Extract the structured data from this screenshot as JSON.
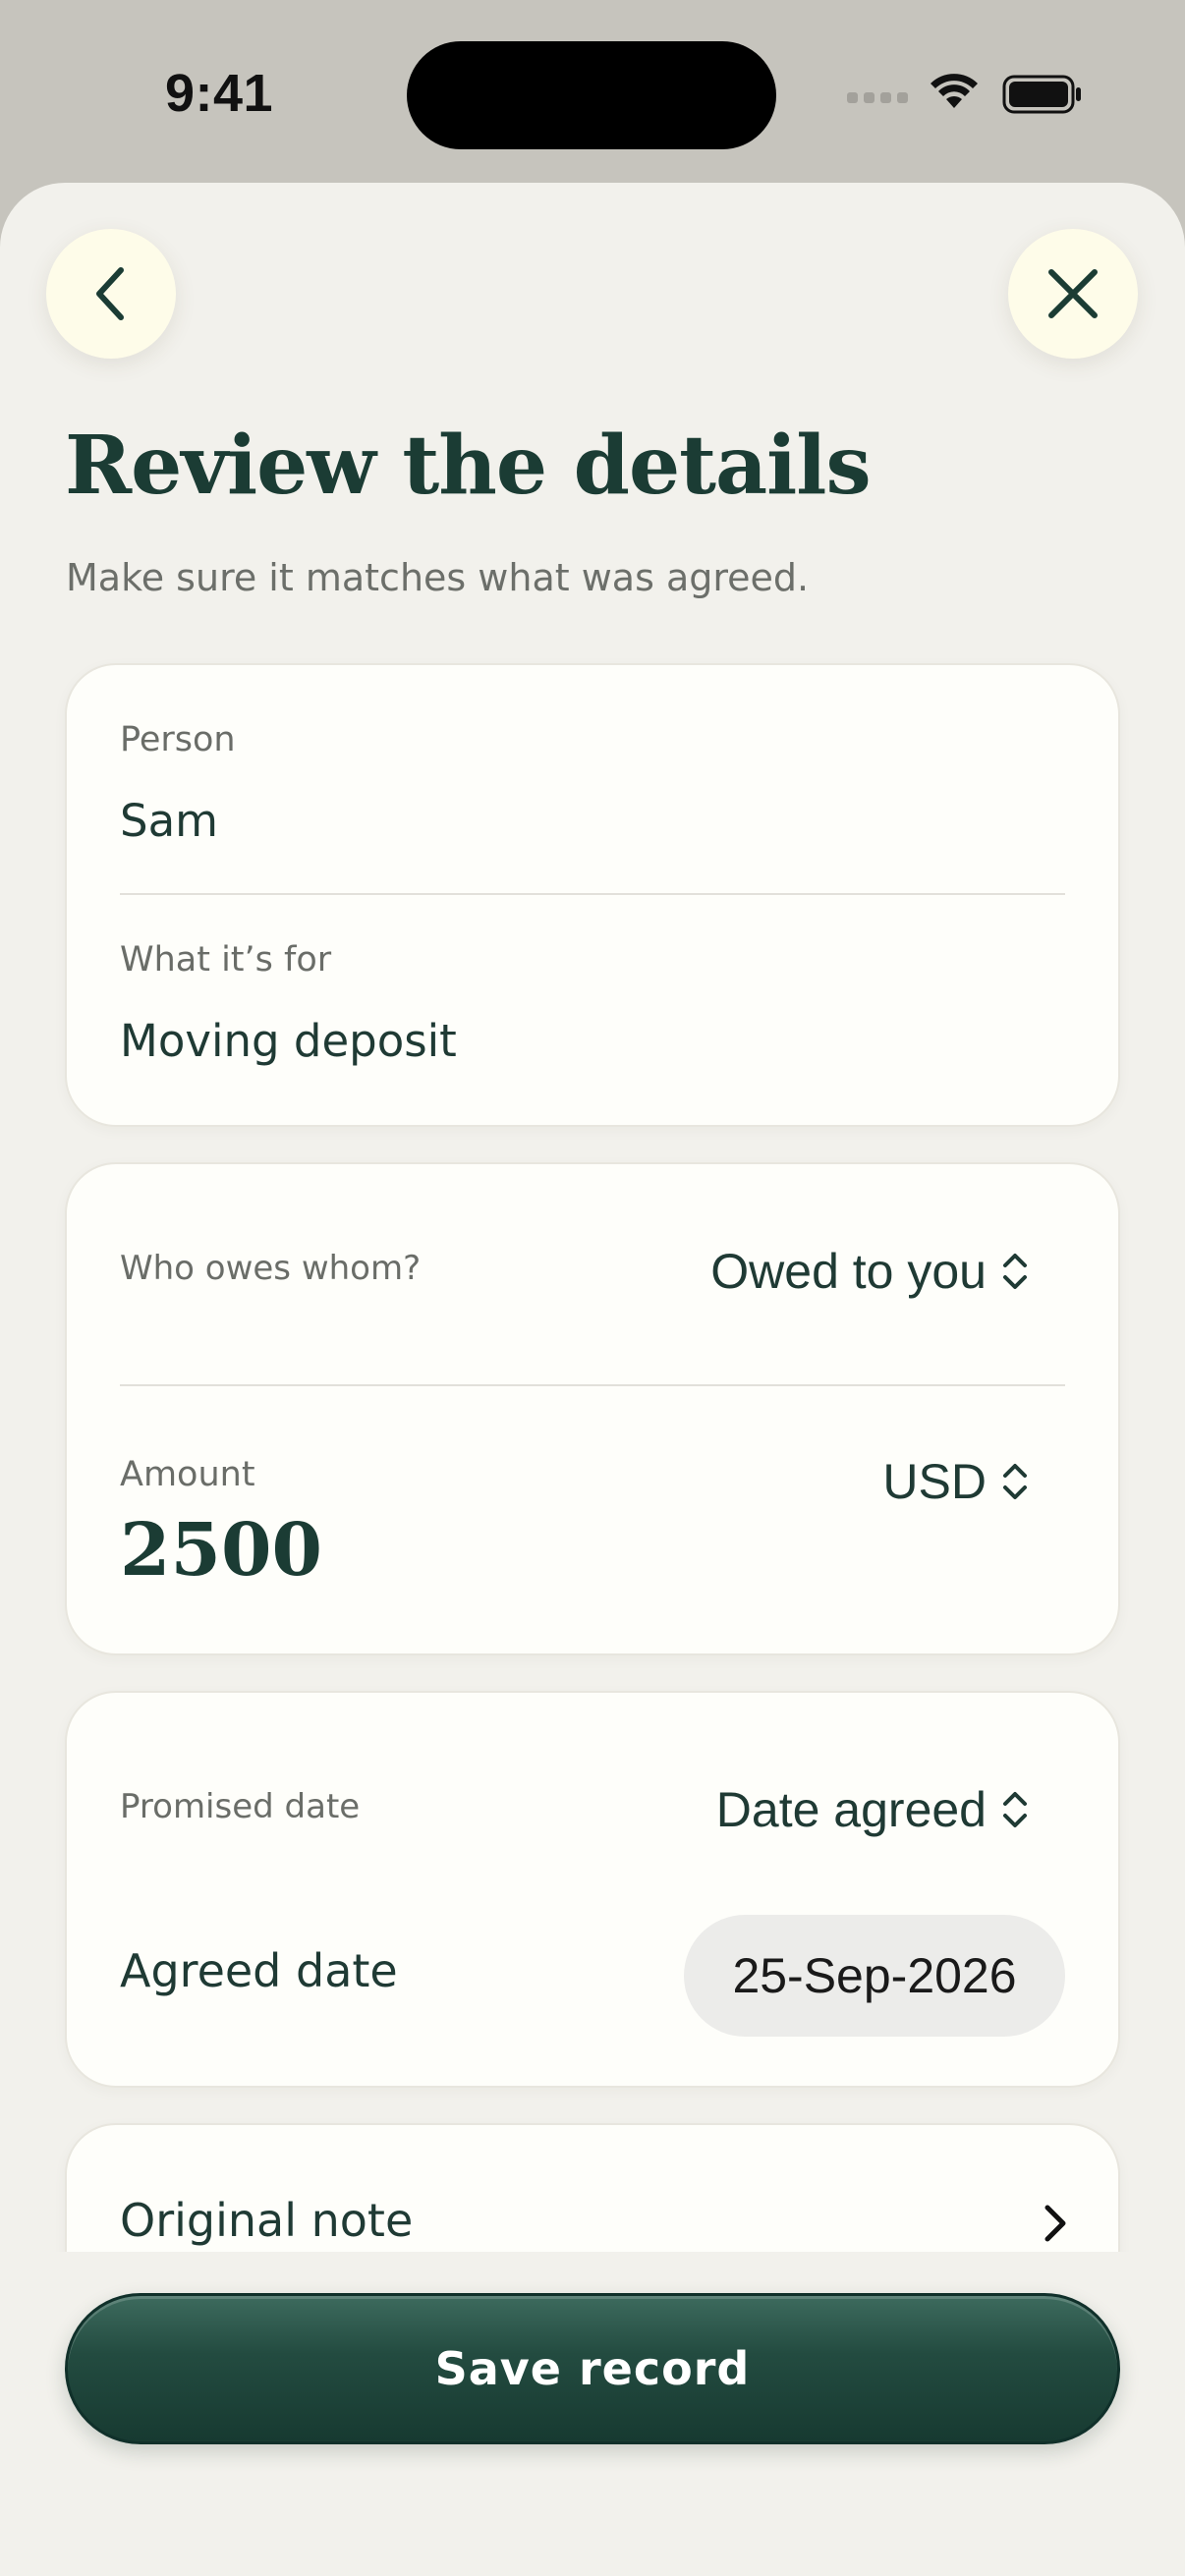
{
  "status_bar": {
    "time": "9:41"
  },
  "header": {
    "back_icon": "chevron-left-icon",
    "close_icon": "close-icon",
    "title": "Review the details",
    "subtitle": "Make sure it matches what was agreed."
  },
  "details_card": {
    "person_label": "Person",
    "person_value": "Sam",
    "purpose_label": "What it’s for",
    "purpose_value": "Moving deposit"
  },
  "amount_card": {
    "direction_label": "Who owes whom?",
    "direction_value": "Owed to you",
    "amount_label": "Amount",
    "amount_value": "2500",
    "currency_value": "USD"
  },
  "date_card": {
    "promised_label": "Promised date",
    "promised_value": "Date agreed",
    "agreed_label": "Agreed date",
    "agreed_value": "25-Sep-2026"
  },
  "note_row": {
    "label": "Original note"
  },
  "actions": {
    "save_label": "Save record"
  },
  "colors": {
    "accent_dark_green": "#1b3c34",
    "button_green": "#234b40",
    "sheet_background": "#f2f1ec",
    "card_background": "#fefefa"
  }
}
